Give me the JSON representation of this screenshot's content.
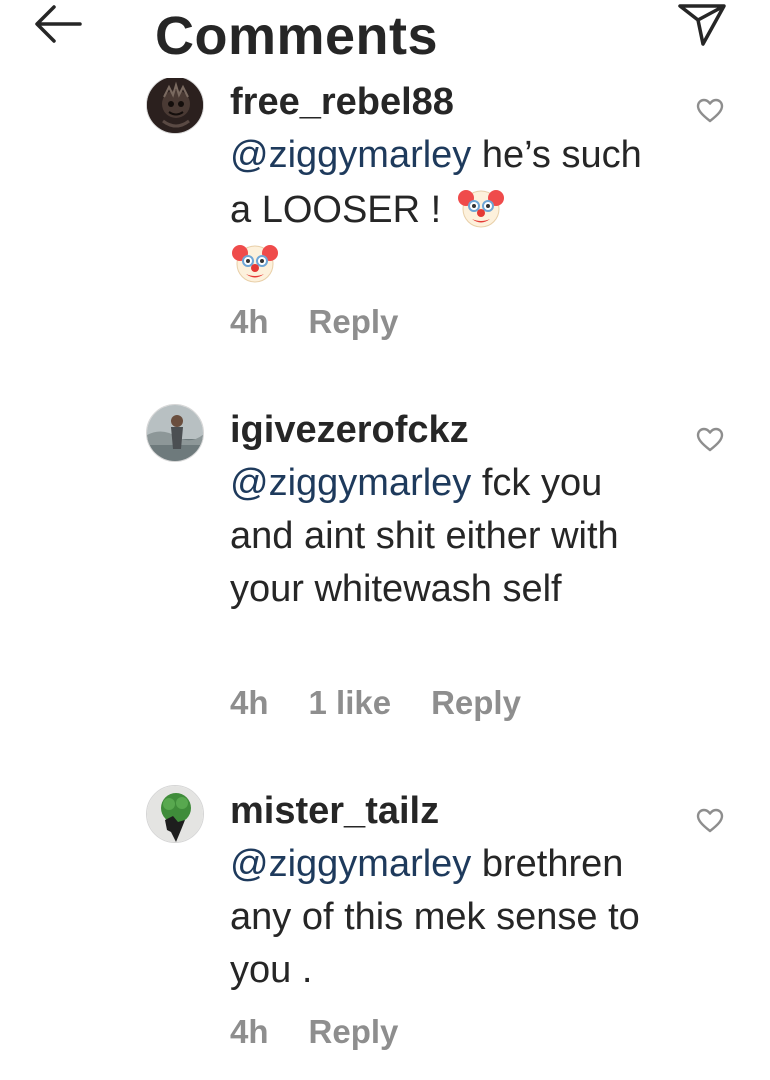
{
  "header": {
    "title": "Comments"
  },
  "comments": [
    {
      "username": "free_rebel88",
      "mention": "@ziggymarley",
      "text": " he’s such a LOOSER ! ",
      "time": "4h",
      "reply_label": "Reply"
    },
    {
      "username": "igivezerofckz",
      "mention": "@ziggymarley",
      "text": " fck you and aint shit either with your whitewash self",
      "time": "4h",
      "likes": "1 like",
      "reply_label": "Reply"
    },
    {
      "username": "mister_tailz",
      "mention": "@ziggymarley",
      "text": " brethren any of this mek sense to you .",
      "time": "4h",
      "reply_label": "Reply"
    }
  ],
  "colors": {
    "text": "#262626",
    "mention": "#1e3a5c",
    "meta": "#8e8e8e",
    "background": "#ffffff"
  }
}
